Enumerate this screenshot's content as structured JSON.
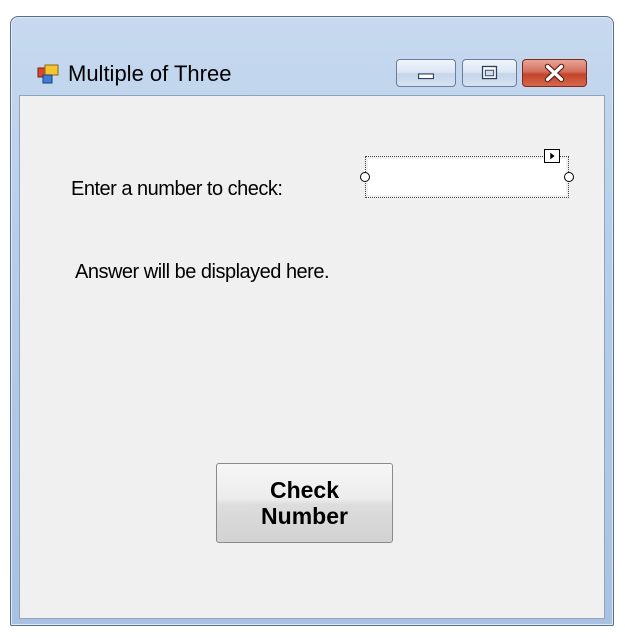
{
  "window": {
    "title": "Multiple of Three",
    "icon": "form-app-icon",
    "controls": {
      "minimize_icon": "minimize-icon",
      "maximize_icon": "maximize-icon",
      "close_icon": "close-icon"
    }
  },
  "form": {
    "prompt_label": "Enter a number to check:",
    "number_input": {
      "value": "",
      "placeholder": ""
    },
    "answer_label": "Answer will be displayed here.",
    "check_button_label": "Check Number",
    "smart_tag_icon": "smart-tag-arrow-icon"
  },
  "colors": {
    "client_background": "#f0f0f0",
    "titlebar_glass": "#b7cde8",
    "close_button": "#c2442b"
  }
}
